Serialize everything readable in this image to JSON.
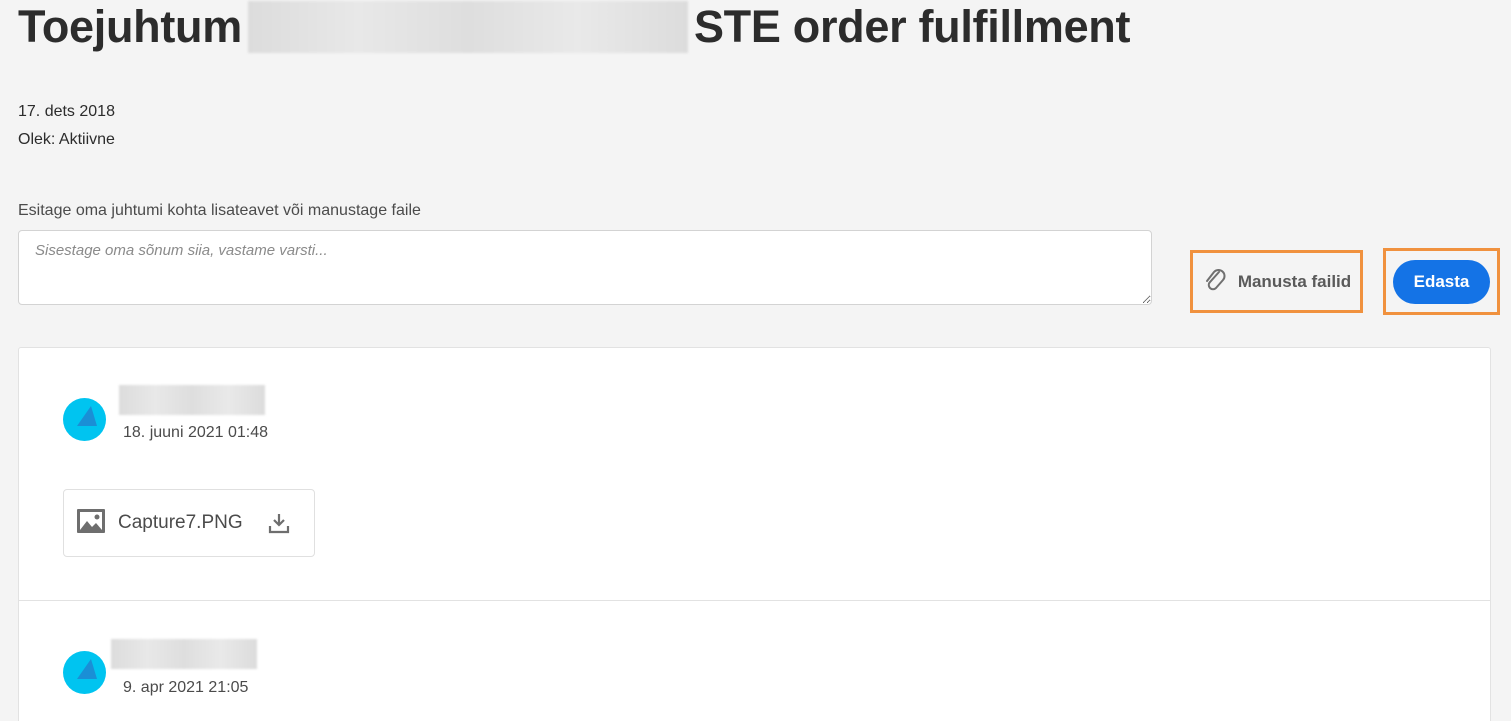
{
  "header": {
    "title_prefix": "Toejuhtum",
    "title_suffix": "STE order fulfillment",
    "date": "17. dets 2018",
    "status": "Olek: Aktiivne"
  },
  "reply": {
    "prompt": "Esitage oma juhtumi kohta lisateavet või manustage faile",
    "placeholder": "Sisestage oma sõnum siia, vastame varsti...",
    "attach_label": "Manusta failid",
    "send_label": "Edasta",
    "accent_color": "#1473e6",
    "highlight_color": "#f0913e"
  },
  "thread": {
    "entries": [
      {
        "timestamp": "18. juuni 2021 01:48",
        "attachment": {
          "file_name": "Capture7.PNG",
          "icon": "image-icon",
          "action_icon": "download-icon"
        }
      },
      {
        "timestamp": "9. apr 2021 21:05"
      }
    ]
  }
}
